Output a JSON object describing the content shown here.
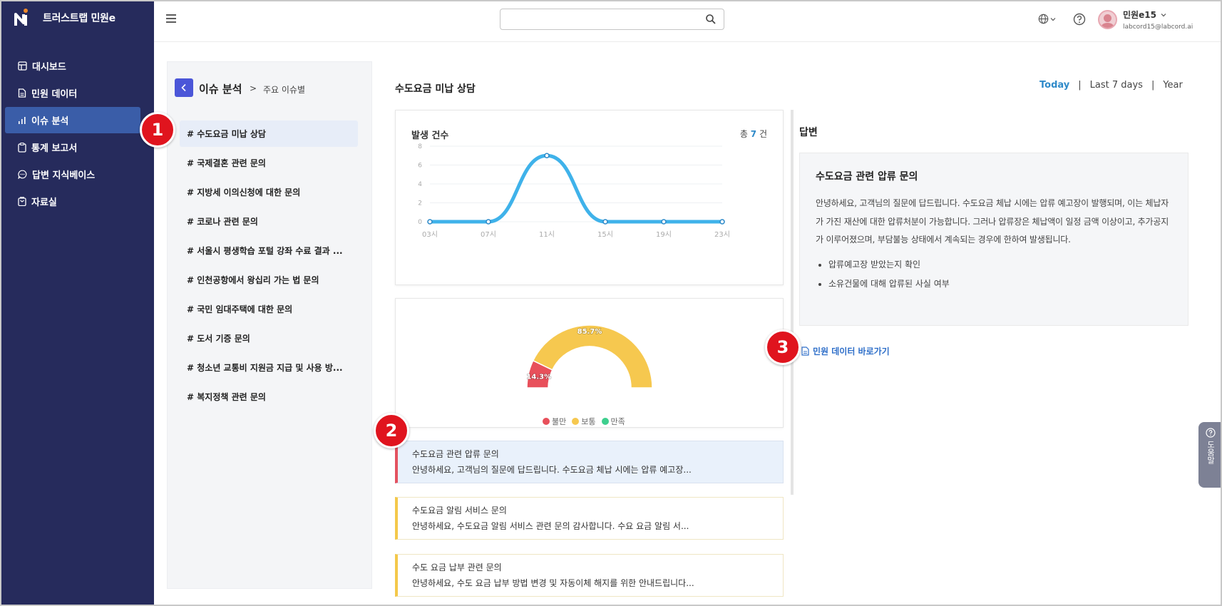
{
  "app": {
    "brand": "트러스트랩 민원e"
  },
  "sidebar": {
    "items": [
      {
        "label": "대시보드",
        "icon": "dashboard-icon"
      },
      {
        "label": "민원 데이터",
        "icon": "document-icon"
      },
      {
        "label": "이슈 분석",
        "icon": "chart-icon",
        "active": true
      },
      {
        "label": "통계 보고서",
        "icon": "clipboard-icon"
      },
      {
        "label": "답변 지식베이스",
        "icon": "chat-icon"
      },
      {
        "label": "자료실",
        "icon": "archive-icon"
      }
    ]
  },
  "header": {
    "search": {
      "value": "",
      "placeholder": ""
    },
    "user": {
      "name": "민원e15",
      "email": "labcord15@labcord.ai"
    }
  },
  "issue_panel": {
    "title": "이슈 분석",
    "crumb_sep": ">",
    "crumb": "주요 이슈별",
    "items": [
      "# 수도요금 미납 상담",
      "# 국제결혼 관련 문의",
      "# 지방세 이의신청에 대한 문의",
      "# 코로나 관련 문의",
      "# 서울시 평생학습 포털 강좌 수료 결과 ...",
      "# 인천공항에서 왕십리 가는 법 문의",
      "# 국민 임대주택에 대한 문의",
      "# 도서 기증 문의",
      "# 청소년 교통비 지원금 지급 및 사용 방...",
      "# 복지정책 관련 문의"
    ]
  },
  "main": {
    "title": "수도요금 미납 상담",
    "range": {
      "today": "Today",
      "sep1": "|",
      "week": "Last 7 days",
      "sep2": "|",
      "year": "Year"
    },
    "chart_card": {
      "title": "발생 건수",
      "total_prefix": "총",
      "total_value": "7",
      "total_suffix": "건"
    },
    "legend": [
      "불만",
      "보통",
      "만족"
    ],
    "answers": [
      {
        "title": "수도요금 관련 압류 문의",
        "snippet": "안녕하세요, 고객님의 질문에 답드립니다. 수도요금 체납 시에는 압류 예고장..."
      },
      {
        "title": "수도요금 알림 서비스 문의",
        "snippet": "안녕하세요, 수도요금 알림 서비스 관련 문의 감사합니다. 수요 요금 알림 서..."
      },
      {
        "title": "수도 요금 납부 관련 문의",
        "snippet": "안녕하세요, 수도 요금 납부 방법 변경 및 자동이체 해지를 위한 안내드립니다..."
      }
    ]
  },
  "answer_panel": {
    "heading": "답변",
    "title": "수도요금 관련 압류 문의",
    "body": "안녕하세요, 고객님의 질문에 답드립니다. 수도요금 체납 시에는 압류 예고장이 발행되며, 이는 체납자가 가진 재산에 대한 압류처분이 가능합니다. 그러나 압류장은 체납액이 일정 금액 이상이고, 추가공지가 이루어졌으며, 부담불능 상태에서 계속되는 경우에 한하여 발생됩니다.",
    "bullets": [
      "압류예고장 받았는지 확인",
      "소유건물에 대해 압류된 사실 여부"
    ],
    "link": "민원 데이터 바로가기"
  },
  "markers": [
    "1",
    "2",
    "3"
  ],
  "help_tab": {
    "label": "도움말"
  },
  "colors": {
    "sidebar": "#262b5c",
    "active": "#3a5da8",
    "line": "#3fb2ea",
    "complaint": "#e8505b",
    "normal": "#f6c84f",
    "satisfied": "#3ecf8e"
  },
  "chart_data": [
    {
      "type": "line",
      "title": "발생 건수",
      "x": [
        "03시",
        "07시",
        "11시",
        "15시",
        "19시",
        "23시"
      ],
      "series": [
        {
          "values": [
            0,
            0,
            7,
            0,
            0,
            0
          ]
        }
      ],
      "ylim": [
        0,
        8
      ],
      "yticks": [
        0,
        2,
        4,
        6,
        8
      ],
      "grid": true,
      "smooth": true
    },
    {
      "type": "pie",
      "variant": "half-donut",
      "categories": [
        "불만",
        "보통",
        "만족"
      ],
      "values": [
        14.3,
        85.7,
        0
      ],
      "labels": [
        "14.3%",
        "85.7%",
        ""
      ],
      "legend": "bottom"
    }
  ]
}
